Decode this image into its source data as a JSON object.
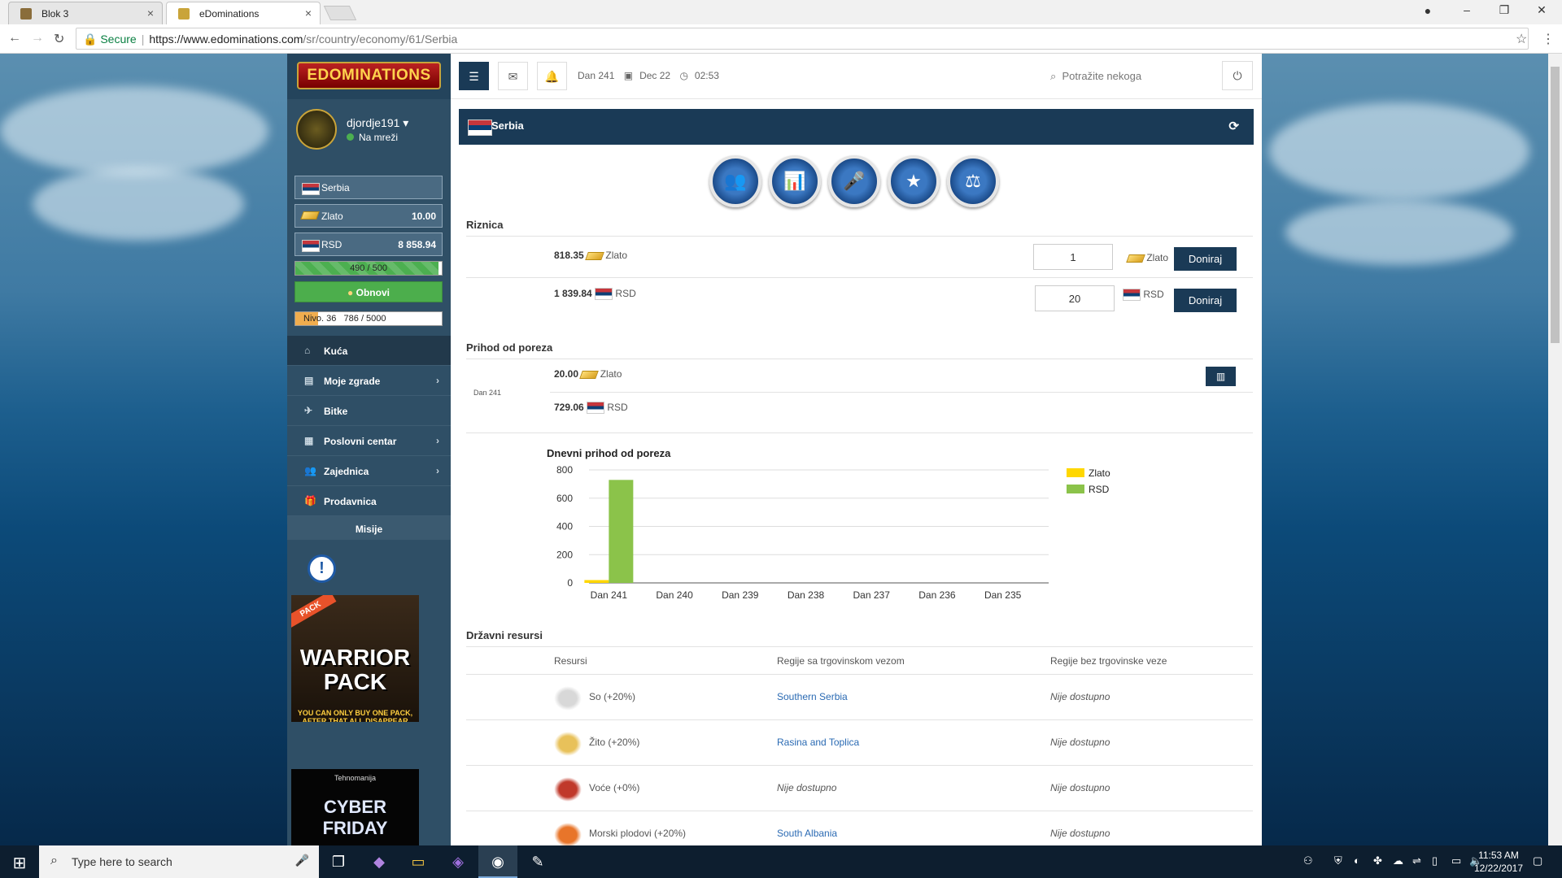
{
  "browser": {
    "tabs": [
      {
        "title": "Blok 3",
        "active": false
      },
      {
        "title": "eDominations",
        "active": true
      }
    ],
    "secure_label": "Secure",
    "url_host": "https://www.edominations.com",
    "url_path": "/sr/country/economy/61/Serbia"
  },
  "sidebar": {
    "logo": "EDOMINATIONS",
    "username": "djordje191",
    "status": "Na mreži",
    "country": "Serbia",
    "gold_label": "Zlato",
    "gold_value": "10.00",
    "currency_label": "RSD",
    "currency_value": "8 858.94",
    "energy_text": "490 / 500",
    "energy_fraction": 0.98,
    "renew_label": "Obnovi",
    "level_label": "Nivo. 36",
    "level_progress": "786 / 5000",
    "level_fraction": 0.157,
    "menu": [
      {
        "label": "Kuća",
        "icon": "home-icon",
        "chevron": false,
        "active": true
      },
      {
        "label": "Moje zgrade",
        "icon": "buildings-icon",
        "chevron": true,
        "active": false
      },
      {
        "label": "Bitke",
        "icon": "plane-icon",
        "chevron": false,
        "active": false
      },
      {
        "label": "Poslovni centar",
        "icon": "business-icon",
        "chevron": true,
        "active": false
      },
      {
        "label": "Zajednica",
        "icon": "community-icon",
        "chevron": true,
        "active": false
      },
      {
        "label": "Prodavnica",
        "icon": "gift-icon",
        "chevron": false,
        "active": false
      }
    ],
    "missions_label": "Misije",
    "promo_badge": "PACK",
    "promo_title": "WARRIOR PACK",
    "promo_subtitle": "YOU CAN ONLY BUY ONE PACK, AFTER THAT ALL DISAPPEAR",
    "ad_brand": "Tehnomanija",
    "ad_text": "CYBER FRIDAY"
  },
  "topbar": {
    "day": "Dan 241",
    "date": "Dec 22",
    "time": "02:53",
    "search_placeholder": "Potražite nekoga"
  },
  "country": {
    "name": "Serbia"
  },
  "treasury": {
    "title": "Riznica",
    "gold_amount": "818.35",
    "gold_label": "Zlato",
    "gold_input": "1",
    "gold_input_label": "Zlato",
    "rsd_amount": "1 839.84",
    "rsd_label": "RSD",
    "rsd_input": "20",
    "rsd_input_label": "RSD",
    "donate_label": "Doniraj"
  },
  "tax_income": {
    "title": "Prihod od poreza",
    "day_label": "Dan 241",
    "gold_amount": "20.00",
    "gold_label": "Zlato",
    "rsd_amount": "729.06",
    "rsd_label": "RSD"
  },
  "chart_data": {
    "type": "bar",
    "title": "Dnevni prihod od poreza",
    "categories": [
      "Dan 241",
      "Dan 240",
      "Dan 239",
      "Dan 238",
      "Dan 237",
      "Dan 236",
      "Dan 235"
    ],
    "series": [
      {
        "name": "Zlato",
        "values": [
          20,
          0,
          0,
          0,
          0,
          0,
          0
        ],
        "color": "#ffd700"
      },
      {
        "name": "RSD",
        "values": [
          729.06,
          0,
          0,
          0,
          0,
          0,
          0
        ],
        "color": "#8bc34a"
      }
    ],
    "ylim": [
      0,
      800
    ],
    "yticks": [
      0,
      200,
      400,
      600,
      800
    ],
    "grid": true,
    "legend": "top-right"
  },
  "resources": {
    "title": "Državni resursi",
    "headers": [
      "Resursi",
      "Regije sa trgovinskom vezom",
      "Regije bez trgovinske veze"
    ],
    "rows": [
      {
        "name": "So (+20%)",
        "icon": "salt-icon",
        "with_trade": "Southern Serbia",
        "with_trade_link": true,
        "without_trade": "Nije dostupno"
      },
      {
        "name": "Žito (+20%)",
        "icon": "wheat-icon",
        "with_trade": "Rasina and Toplica",
        "with_trade_link": true,
        "without_trade": "Nije dostupno"
      },
      {
        "name": "Voće (+0%)",
        "icon": "fruit-icon",
        "with_trade": "Nije dostupno",
        "with_trade_link": false,
        "without_trade": "Nije dostupno"
      },
      {
        "name": "Morski plodovi (+20%)",
        "icon": "shrimp-icon",
        "with_trade": "South Albania",
        "with_trade_link": true,
        "without_trade": "Nije dostupno"
      }
    ]
  },
  "taskbar": {
    "search_placeholder": "Type here to search",
    "time": "11:53 AM",
    "date": "12/22/2017"
  }
}
